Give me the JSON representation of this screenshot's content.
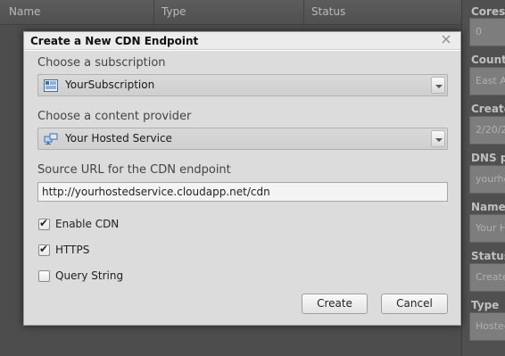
{
  "grid": {
    "columns": [
      "Name",
      "Type",
      "Status"
    ]
  },
  "right_panel": {
    "fields": [
      {
        "label": "Cores",
        "value": "0"
      },
      {
        "label": "Country",
        "value": "East A"
      },
      {
        "label": "Created",
        "value": "2/20/2"
      },
      {
        "label": "DNS p",
        "value": "yourho"
      },
      {
        "label": "Name",
        "value": "Your H"
      },
      {
        "label": "Status",
        "value": "Create"
      },
      {
        "label": "Type",
        "value": "Hosted"
      }
    ]
  },
  "dialog": {
    "title": "Create a New CDN Endpoint",
    "close_icon": "close-icon",
    "subscription": {
      "label": "Choose a subscription",
      "value": "YourSubscription",
      "icon": "subscription-icon"
    },
    "provider": {
      "label": "Choose a content provider",
      "value": "Your Hosted Service",
      "icon": "hosted-service-icon"
    },
    "source_url": {
      "label": "Source URL for the CDN endpoint",
      "value": "http://yourhostedservice.cloudapp.net/cdn"
    },
    "options": [
      {
        "label": "Enable CDN",
        "checked": true
      },
      {
        "label": "HTTPS",
        "checked": true
      },
      {
        "label": "Query String",
        "checked": false
      }
    ],
    "create_label": "Create",
    "cancel_label": "Cancel"
  }
}
